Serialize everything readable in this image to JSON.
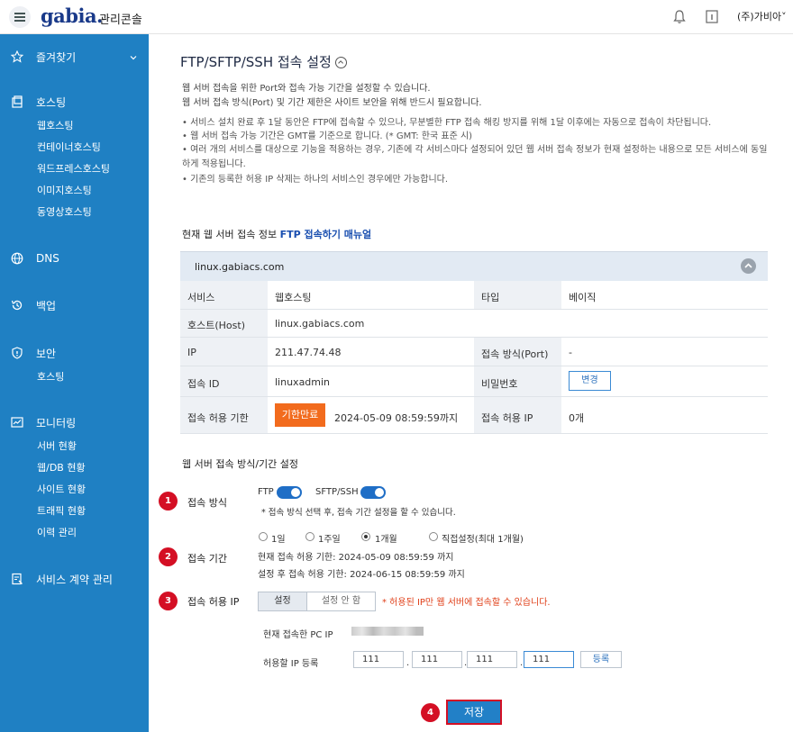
{
  "topbar": {
    "logo": "gabia.",
    "console_label": "관리콘솔",
    "user": "(주)가비아˅"
  },
  "sidebar": {
    "sections": [
      {
        "label": "즐겨찾기",
        "icon": "star-icon",
        "items": []
      },
      {
        "label": "호스팅",
        "icon": "hosting-icon",
        "items": [
          "웹호스팅",
          "컨테이너호스팅",
          "워드프레스호스팅",
          "이미지호스팅",
          "동영상호스팅"
        ]
      },
      {
        "label": "DNS",
        "icon": "globe-icon",
        "items": []
      },
      {
        "label": "백업",
        "icon": "backup-icon",
        "items": []
      },
      {
        "label": "보안",
        "icon": "shield-icon",
        "items": [
          "호스팅"
        ]
      },
      {
        "label": "모니터링",
        "icon": "monitor-icon",
        "items": [
          "서버 현황",
          "웹/DB 현황",
          "사이트 현황",
          "트래픽 현황",
          "이력 관리"
        ]
      },
      {
        "label": "서비스 계약 관리",
        "icon": "contract-icon",
        "items": []
      }
    ]
  },
  "page": {
    "title": "FTP/SFTP/SSH 접속 설정",
    "desc": [
      "웹 서버 접속을 위한 Port와 접속 가능 기간을 설정할 수 있습니다.",
      "웹 서버 접속 방식(Port) 및 기간 제한은 사이트 보안을 위해 반드시 필요합니다."
    ],
    "bullets": [
      "•  서비스 설치 완료 후 1달 동안은 FTP에 접속할 수 있으나, 무분별한 FTP 접속 해킹 방지를 위해 1달 이후에는 자동으로 접속이 차단됩니다.",
      "•  웹 서버 접속 가능 기간은 GMT를 기준으로 합니다. (* GMT: 한국 표준 시)",
      "•  여러 개의 서비스를 대상으로 기능을 적용하는 경우, 기존에 각 서비스마다 설정되어 있던 웹 서버 접속 정보가 현재 설정하는 내용으로 모든 서비스에 동일",
      "    하게 적용됩니다.",
      "•  기존의 등록한 허용 IP 삭제는 하나의 서비스인 경우에만 가능합니다."
    ]
  },
  "info": {
    "section_title": "현재 웹 서버 접속 정보",
    "manual_link": "FTP 접속하기 매뉴얼",
    "host_header": "linux.gabiacs.com",
    "rows": [
      {
        "l1": "서비스",
        "v1": "웹호스팅",
        "l2": "타입",
        "v2": "베이직"
      },
      {
        "l1": "호스트(Host)",
        "v1": "linux.gabiacs.com"
      },
      {
        "l1": "IP",
        "v1": "211.47.74.48",
        "l2": "접속 방식(Port)",
        "v2": "-"
      },
      {
        "l1": "접속 ID",
        "v1": "linuxadmin",
        "l2": "비밀번호",
        "change_label": "변경"
      },
      {
        "l1": "접속 허용 기한",
        "expired_label": "기한만료",
        "v1": "2024-05-09 08:59:59까지",
        "l2": "접속 허용 IP",
        "v2": "0개"
      }
    ]
  },
  "settings": {
    "section_title": "웹 서버 접속 방식/기간 설정",
    "steps": [
      "1",
      "2",
      "3",
      "4"
    ],
    "method": {
      "label": "접속 방식",
      "ftp_label": "FTP",
      "ftp_on": true,
      "sftp_label": "SFTP/SSH",
      "sftp_on": true,
      "note": "* 접속 방식 선택 후, 접속 기간 설정을 할 수 있습니다."
    },
    "period": {
      "label": "접속 기간",
      "options": [
        "1일",
        "1주일",
        "1개월",
        "직접설정(최대 1개월)"
      ],
      "selected": "1개월",
      "current": "현재 접속 허용 기한: 2024-05-09 08:59:59 까지",
      "after": "설정 후 접속 허용 기한: 2024-06-15 08:59:59 까지"
    },
    "ip": {
      "label": "접속 허용 IP",
      "set_label": "설정",
      "unset_label": "설정 안 함",
      "note": "* 허용된 IP만 웹 서버에 접속할 수 있습니다.",
      "current_pc_label": "현재 접속한 PC IP",
      "register_label": "허용할 IP 등록",
      "octets": [
        "111",
        "111",
        "111",
        "111"
      ],
      "register_button": "등록"
    },
    "save_label": "저장"
  },
  "colors": {
    "sidebar": "#1f80c3",
    "accent": "#1f6ec6",
    "expired": "#f26b1d",
    "step": "#d40f24",
    "note_red": "#e0401a"
  }
}
